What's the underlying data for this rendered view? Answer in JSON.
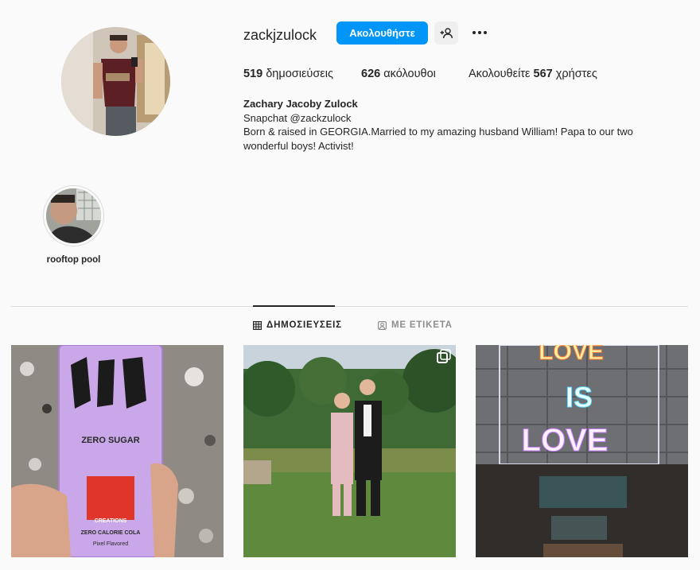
{
  "profile": {
    "username": "zackjzulock",
    "follow_label": "Ακολουθήστε",
    "full_name": "Zachary Jacoby Zulock",
    "bio_line1": "Snapchat @zackzulock",
    "bio_line2": "Born & raised in GEORGIA.Married to my amazing husband William! Papa to our two wonderful boys! Activist!"
  },
  "stats": {
    "posts_count": "519",
    "posts_label": "δημοσιεύσεις",
    "followers_count": "626",
    "followers_label": "ακόλουθοι",
    "following_prefix": "Ακολουθείτε",
    "following_count": "567",
    "following_suffix": "χρήστες"
  },
  "highlights": [
    {
      "label": "rooftop pool"
    }
  ],
  "tabs": {
    "posts": "ΔΗΜΟΣΙΕΥΣΕΙΣ",
    "tagged": "ΜΕ ΕΤΙΚΕΤΑ"
  },
  "post_texts": {
    "can_zero_sugar": "ZERO SUGAR",
    "can_creations": "CREATIONS",
    "can_zero_calorie": "ZERO CALORIE COLA",
    "can_pixel": "Pixel Flavored",
    "neon_love_top": "LOVE",
    "neon_is": "IS",
    "neon_love": "LOVE"
  },
  "colors": {
    "accent": "#0095f6",
    "text": "#262626",
    "muted": "#8e8e8e",
    "background": "#fafafa"
  }
}
